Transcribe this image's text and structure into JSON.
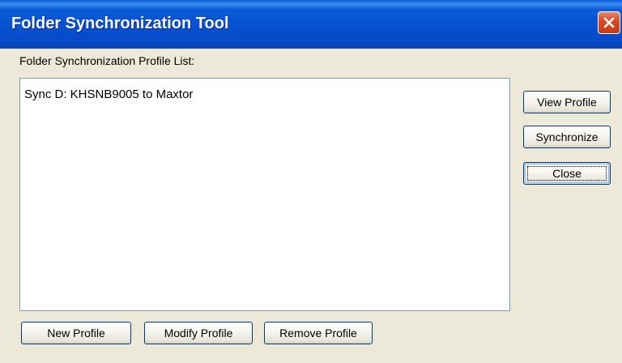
{
  "window": {
    "title": "Folder Synchronization Tool"
  },
  "profile_list": {
    "label": "Folder Synchronization Profile List:",
    "items": [
      "Sync D: KHSNB9005 to Maxtor"
    ]
  },
  "side_buttons": {
    "view_profile": "View Profile",
    "synchronize": "Synchronize",
    "close": "Close"
  },
  "bottom_buttons": {
    "new_profile": "New Profile",
    "modify_profile": "Modify Profile",
    "remove_profile": "Remove Profile"
  },
  "icons": {
    "close_window": "close-icon"
  },
  "colors": {
    "titlebar_blue": "#0550d0",
    "close_red": "#d84a22",
    "dialog_face": "#ece9d8",
    "list_border": "#7f9db9"
  }
}
